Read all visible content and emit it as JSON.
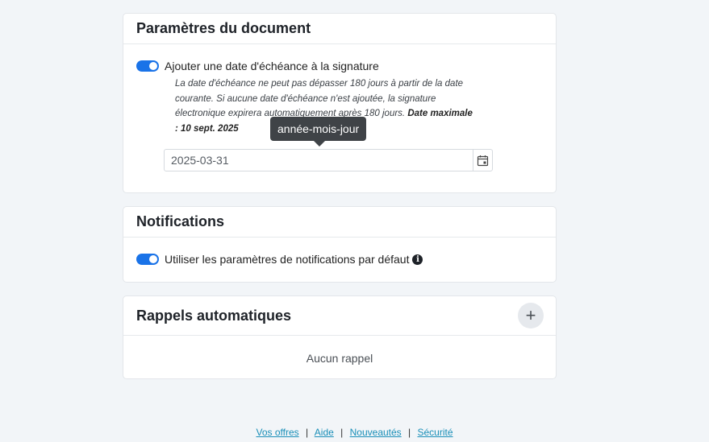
{
  "document_settings": {
    "title": "Paramètres du document",
    "due_date_toggle_label": "Ajouter une date d'échéance à la signature",
    "help_text": "La date d'échéance ne peut pas dépasser 180 jours à partir de la date courante. Si aucune date d'échéance n'est ajoutée, la signature électronique expirera automatiquement après 180 jours.",
    "help_text_bold": "Date maximale : 10 sept. 2025",
    "date_value": "2025-03-31",
    "tooltip": "année-mois-jour",
    "due_date_enabled": true
  },
  "notifications": {
    "title": "Notifications",
    "toggle_label": "Utiliser les paramètres de notifications par défaut",
    "toggle_enabled": true
  },
  "reminders": {
    "title": "Rappels automatiques",
    "add_symbol": "+",
    "empty_text": "Aucun rappel"
  },
  "footer": {
    "links": [
      "Vos offres",
      "Aide",
      "Nouveautés",
      "Sécurité"
    ],
    "separator": "|"
  },
  "colors": {
    "toggle_on": "#1a73e8",
    "link": "#1a8fb8",
    "tooltip_bg": "#3f4347"
  }
}
